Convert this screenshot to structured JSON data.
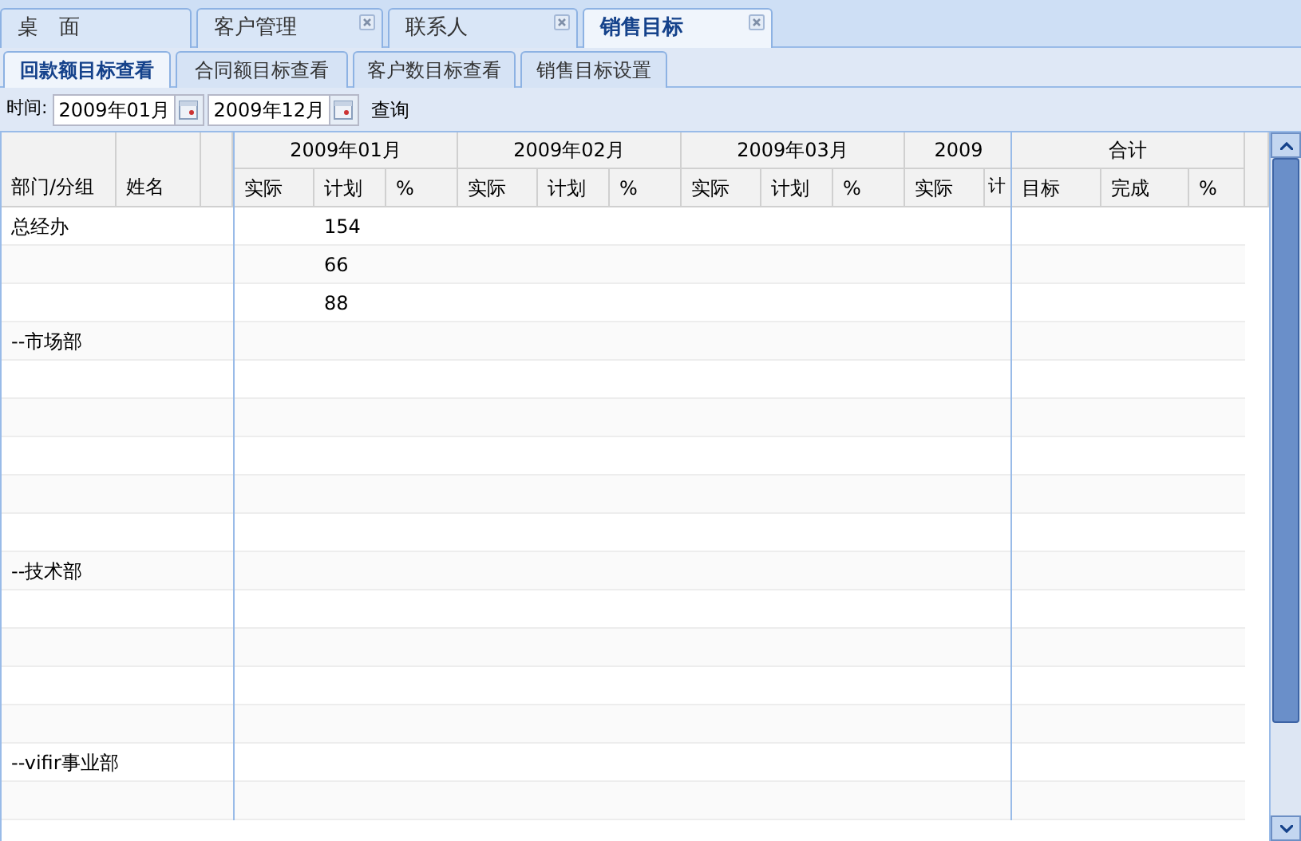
{
  "tabs": [
    {
      "label": "桌　面",
      "selected": false,
      "closable": false
    },
    {
      "label": "客户管理",
      "selected": false,
      "closable": true
    },
    {
      "label": "联系人",
      "selected": false,
      "closable": true
    },
    {
      "label": "销售目标",
      "selected": true,
      "closable": true
    }
  ],
  "subtabs": [
    {
      "label": "回款额目标查看",
      "selected": true
    },
    {
      "label": "合同额目标查看",
      "selected": false
    },
    {
      "label": "客户数目标查看",
      "selected": false
    },
    {
      "label": "销售目标设置",
      "selected": false
    }
  ],
  "toolbar": {
    "time_label": "时间:",
    "from": "2009年01月",
    "to": "2009年12月",
    "query": "查询"
  },
  "grid": {
    "columns": [
      "部门/分组",
      "姓名"
    ],
    "months": [
      {
        "title": "2009年01月",
        "columns": [
          "实际",
          "计划",
          "%"
        ]
      },
      {
        "title": "2009年02月",
        "columns": [
          "实际",
          "计划",
          "%"
        ]
      },
      {
        "title": "2009年03月",
        "columns": [
          "实际",
          "计划",
          "%"
        ]
      },
      {
        "title": "2009",
        "columns": [
          "实际",
          "计"
        ]
      }
    ],
    "total": {
      "title": "合计",
      "columns": [
        "目标",
        "完成",
        "%"
      ]
    },
    "rows": [
      {
        "dept": "总经办",
        "plan": "154"
      },
      {
        "plan": "66"
      },
      {
        "plan": "88"
      },
      {
        "dept": "--市场部"
      },
      {},
      {},
      {},
      {},
      {},
      {
        "dept": "--技术部"
      },
      {},
      {},
      {},
      {},
      {
        "dept": "--vifir事业部"
      },
      {}
    ]
  }
}
